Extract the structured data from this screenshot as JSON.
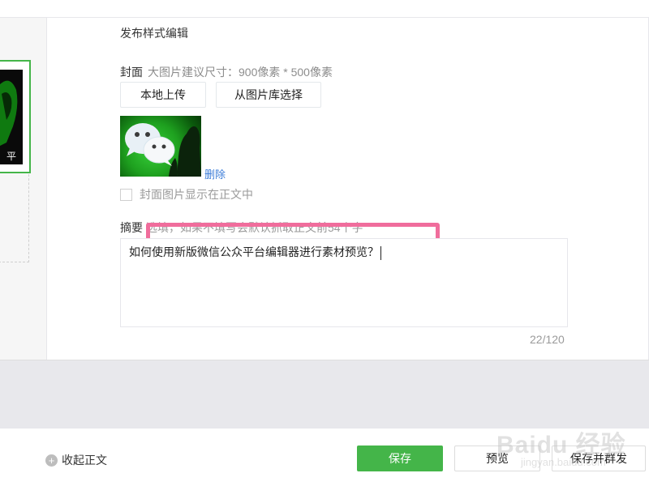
{
  "editor": {
    "publish_style_title": "发布样式编辑",
    "cover": {
      "label": "封面",
      "hint": "大图片建议尺寸：900像素 * 500像素",
      "upload_label": "本地上传",
      "library_label": "从图片库选择",
      "delete_label": "删除",
      "show_in_body_label": "封面图片显示在正文中",
      "show_in_body_checked": false
    },
    "summary": {
      "label": "摘要",
      "hint": "选填，如果不填写会默认抓取正文前54个字",
      "value": "如何使用新版微信公众平台编辑器进行素材预览？",
      "char_count": "22/120"
    },
    "left_thumb_text": "平"
  },
  "bottom_bar": {
    "collapse_label": "收起正文",
    "save_label": "保存",
    "preview_label": "预览",
    "save_send_label": "保存并群发"
  },
  "watermark": {
    "text": "Baidu 经验",
    "url": "jingyan.baidu.com"
  },
  "colors": {
    "accent_green": "#44b549",
    "highlight_pink": "#f06d9c",
    "link_blue": "#3d7dd8"
  }
}
